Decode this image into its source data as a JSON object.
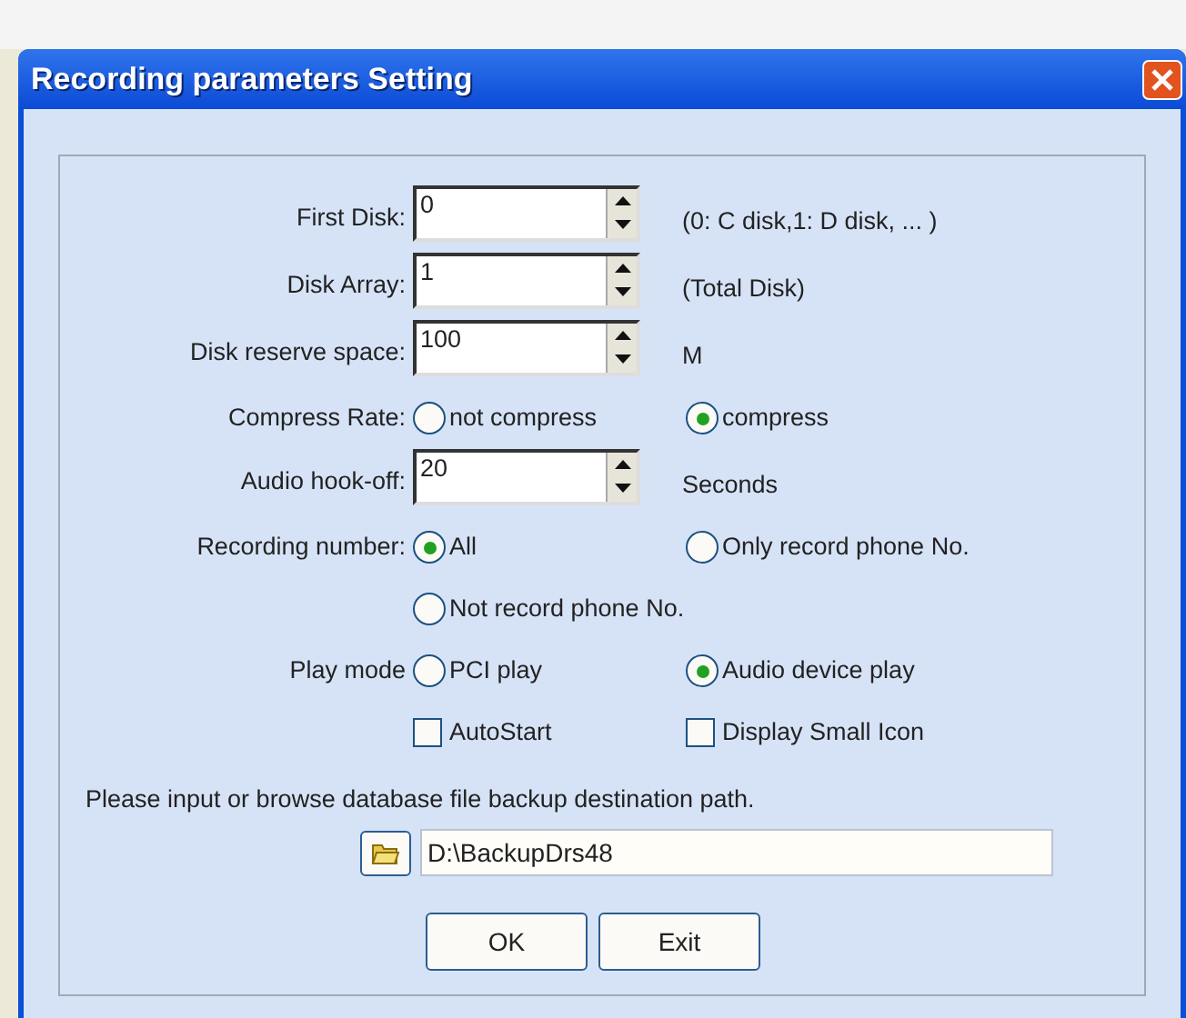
{
  "window": {
    "title": "Recording parameters Setting"
  },
  "rows": [
    {
      "kind": "spin",
      "label": "First Disk:",
      "value": "0",
      "note": "(0: C disk,1: D disk, ... )"
    },
    {
      "kind": "spin",
      "label": "Disk Array:",
      "value": "1",
      "note": "(Total Disk)"
    },
    {
      "kind": "spin",
      "label": "Disk reserve space:",
      "value": "100",
      "note": "M"
    },
    {
      "kind": "radio",
      "label": "Compress Rate:",
      "options": [
        {
          "label": "not compress",
          "selected": false
        },
        {
          "label": "compress",
          "selected": true
        }
      ]
    },
    {
      "kind": "spin",
      "label": "Audio hook-off:",
      "value": "20",
      "note": "Seconds"
    },
    {
      "kind": "radio",
      "label": "Recording number:",
      "options": [
        {
          "label": "All",
          "selected": true
        },
        {
          "label": "Only record phone No.",
          "selected": false
        },
        {
          "label": "Not record phone No.",
          "selected": false
        }
      ]
    },
    {
      "kind": "radio",
      "label": "Play mode",
      "options": [
        {
          "label": "PCI play",
          "selected": false
        },
        {
          "label": "Audio device play",
          "selected": true
        }
      ]
    },
    {
      "kind": "check",
      "options": [
        {
          "label": "AutoStart",
          "checked": false
        },
        {
          "label": "Display Small Icon",
          "checked": false
        }
      ]
    }
  ],
  "backup": {
    "prompt": "Please input or browse database file backup destination path.",
    "path": "D:\\BackupDrs48"
  },
  "buttons": [
    "OK",
    "Exit"
  ]
}
